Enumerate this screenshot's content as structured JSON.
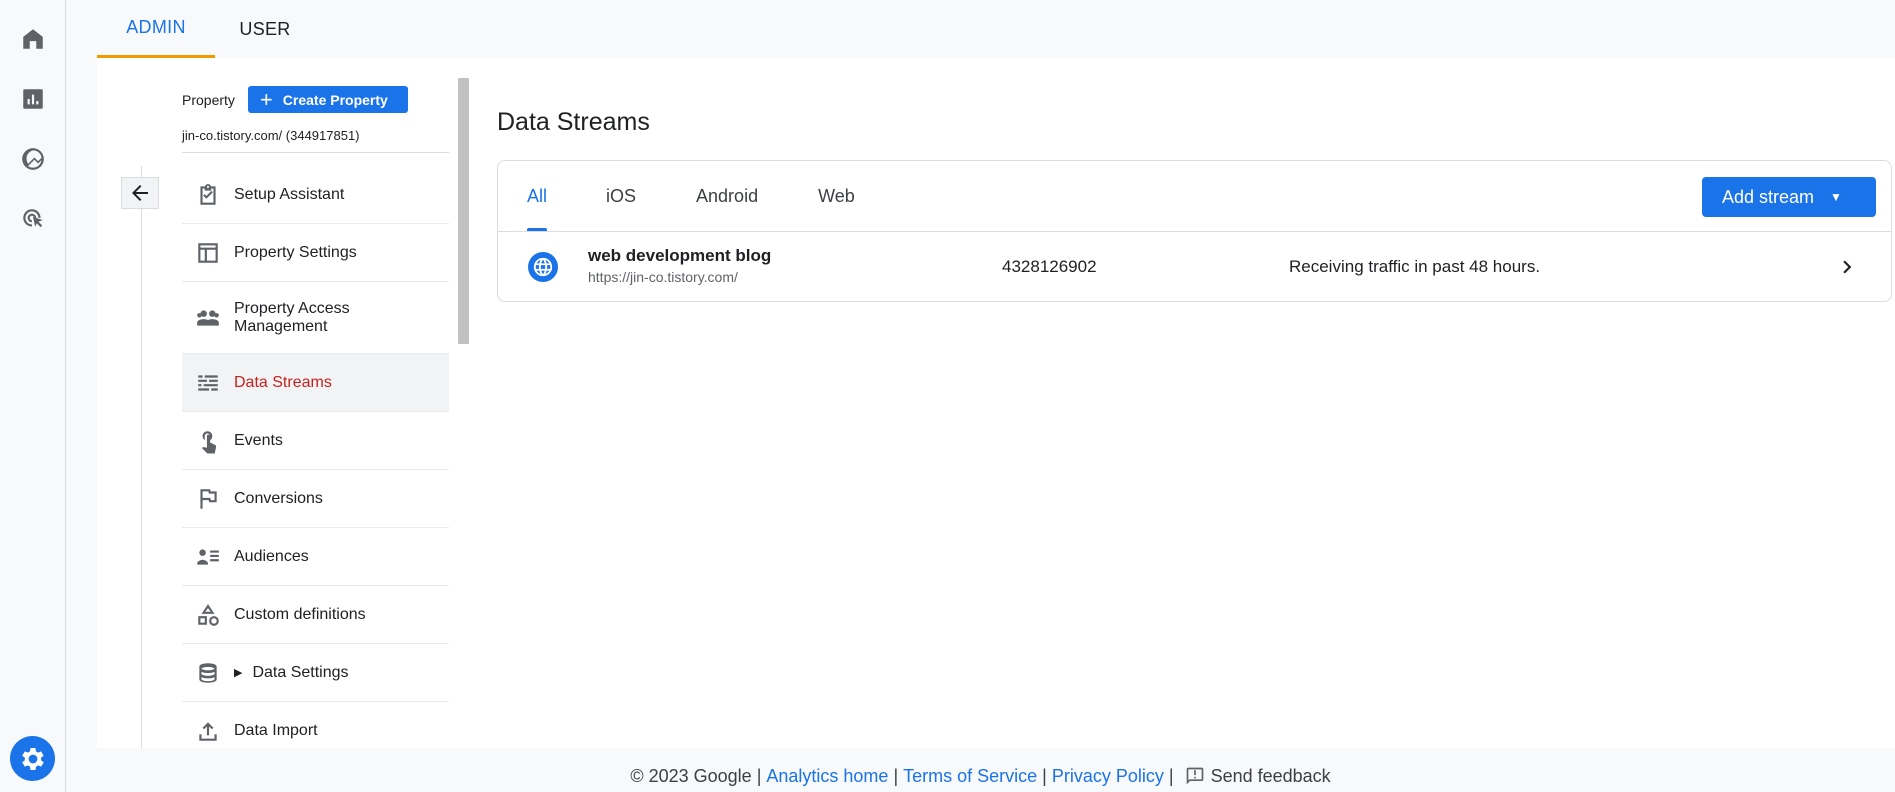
{
  "rail": {
    "items": [
      {
        "icon": "home-icon"
      },
      {
        "icon": "reports-icon"
      },
      {
        "icon": "explore-icon"
      },
      {
        "icon": "advertising-icon"
      }
    ],
    "settings_icon": "gear-icon"
  },
  "top_tabs": [
    {
      "label": "ADMIN",
      "active": true
    },
    {
      "label": "USER",
      "active": false
    }
  ],
  "property": {
    "label": "Property",
    "create_button": "Create Property",
    "name": "jin-co.tistory.com/ (344917851)"
  },
  "nav": {
    "items": [
      {
        "label": "Setup Assistant",
        "icon": "checklist-icon"
      },
      {
        "label": "Property Settings",
        "icon": "property-settings-icon"
      },
      {
        "label": "Property Access Management",
        "icon": "people-icon"
      },
      {
        "label": "Data Streams",
        "icon": "data-streams-icon",
        "active": true
      },
      {
        "label": "Events",
        "icon": "touch-icon"
      },
      {
        "label": "Conversions",
        "icon": "flag-icon"
      },
      {
        "label": "Audiences",
        "icon": "audiences-icon"
      },
      {
        "label": "Custom definitions",
        "icon": "shapes-icon"
      },
      {
        "label": "Data Settings",
        "icon": "database-icon",
        "expandable": true
      },
      {
        "label": "Data Import",
        "icon": "upload-icon"
      }
    ]
  },
  "main": {
    "title": "Data Streams",
    "tabs": [
      {
        "label": "All",
        "active": true
      },
      {
        "label": "iOS"
      },
      {
        "label": "Android"
      },
      {
        "label": "Web"
      }
    ],
    "add_stream_button": "Add stream",
    "streams": [
      {
        "icon": "globe-icon",
        "name": "web development blog",
        "url": "https://jin-co.tistory.com/",
        "id": "4328126902",
        "status": "Receiving traffic in past 48 hours."
      }
    ]
  },
  "footer": {
    "copyright": "© 2023 Google",
    "links": [
      "Analytics home",
      "Terms of Service",
      "Privacy Policy"
    ],
    "feedback": "Send feedback"
  },
  "colors": {
    "accent": "#1a73e8",
    "active_nav_text": "#c5221f",
    "tab_underline": "#f29900"
  }
}
